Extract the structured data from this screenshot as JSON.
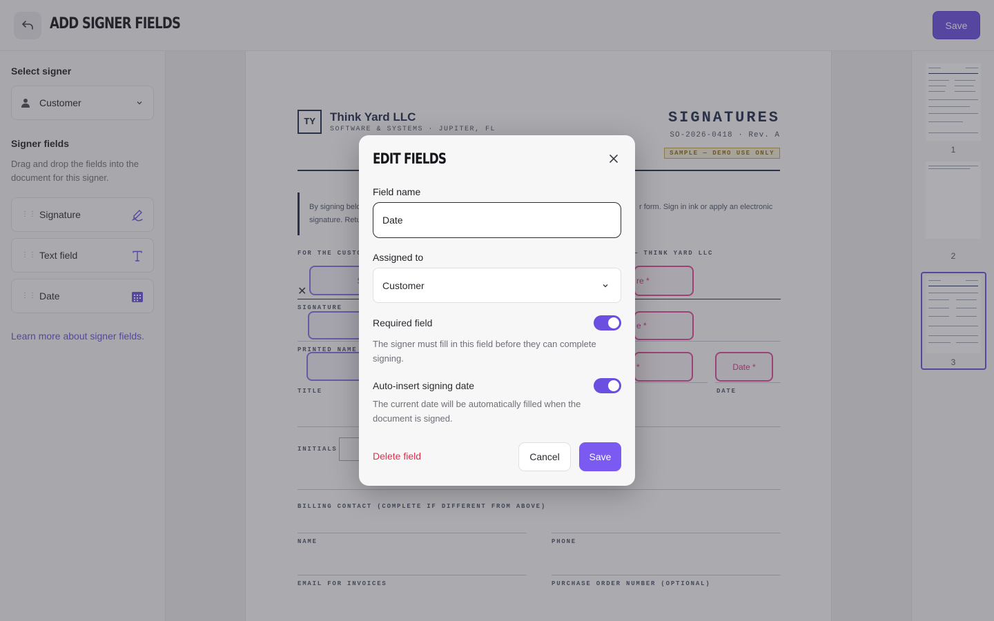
{
  "header": {
    "title": "ADD SIGNER FIELDS",
    "save_label": "Save"
  },
  "sidebar": {
    "select_signer_label": "Select signer",
    "selected_signer": "Customer",
    "signer_fields_label": "Signer fields",
    "help_text": "Drag and drop the fields into the document for this signer.",
    "fields": [
      {
        "label": "Signature",
        "icon": "signature-icon"
      },
      {
        "label": "Text field",
        "icon": "text-icon"
      },
      {
        "label": "Date",
        "icon": "calendar-icon"
      }
    ],
    "learn_link": "Learn more about signer fields."
  },
  "document": {
    "logo": "TY",
    "company": "Think Yard LLC",
    "company_sub": "SOFTWARE & SYSTEMS · JUPITER, FL",
    "title": "SIGNATURES",
    "doc_number": "SO-2026-0418 · Rev. A",
    "badge": "SAMPLE — DEMO USE ONLY",
    "intro_left": "By signing belo",
    "intro_left2": "signature. Retu",
    "intro_right": "r form. Sign in ink or apply an electronic",
    "section_customer": "FOR THE CUSTO",
    "section_vendor": "— THINK YARD LLC",
    "labels": {
      "signature": "SIGNATURE",
      "printed_name": "PRINTED NAME",
      "title": "TITLE",
      "date": "DATE",
      "initials": "INITIALS",
      "billing": "BILLING CONTACT (COMPLETE IF DIFFERENT FROM ABOVE)",
      "name": "NAME",
      "phone": "PHONE",
      "email": "EMAIL FOR INVOICES",
      "po": "PURCHASE ORDER NUMBER (OPTIONAL)"
    },
    "fields": {
      "sig_customer": "Si",
      "sig_vendor": "re *",
      "name_vendor": "e *",
      "title_vendor": "*",
      "date_vendor": "Date *"
    }
  },
  "thumbnails": {
    "pages": [
      "1",
      "2",
      "3"
    ],
    "selected": "3"
  },
  "modal": {
    "title": "EDIT FIELDS",
    "field_name_label": "Field name",
    "field_name_value": "Date",
    "assigned_to_label": "Assigned to",
    "assigned_to_value": "Customer",
    "required_label": "Required field",
    "required_help": "The signer must fill in this field before they can complete signing.",
    "required_on": true,
    "auto_date_label": "Auto-insert signing date",
    "auto_date_help": "The current date will be automatically filled when the document is signed.",
    "auto_date_on": true,
    "delete_label": "Delete field",
    "cancel_label": "Cancel",
    "save_label": "Save"
  },
  "colors": {
    "accent": "#6b4fe0",
    "danger": "#e02f4a",
    "field_pink": "#e0499a",
    "navy": "#1e2a4a"
  }
}
